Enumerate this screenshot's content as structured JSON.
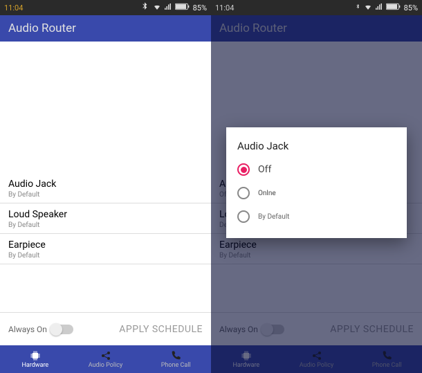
{
  "statusbar": {
    "time": "11:04",
    "battery_pct": "85%"
  },
  "appbar": {
    "title": "Audio Router"
  },
  "settings": [
    {
      "title": "Audio Jack",
      "sub": "By Default"
    },
    {
      "title": "Loud Speaker",
      "sub": "By Default"
    },
    {
      "title": "Earpiece",
      "sub": "By Default"
    }
  ],
  "settings2": [
    {
      "title_trunc": "Au",
      "sub_trunc": "Off"
    },
    {
      "title_trunc": "Lou",
      "sub_trunc": "De"
    },
    {
      "title": "Earpiece",
      "sub": "By Default"
    }
  ],
  "schedule": {
    "always_on": "Always On",
    "apply": "APPLY SCHEDULE"
  },
  "nav": {
    "hardware": "Hardware",
    "audio_policy": "Audio Policy",
    "phone_call": "Phone Call"
  },
  "dialog": {
    "title": "Audio Jack",
    "options": [
      {
        "label": "Off",
        "checked": true
      },
      {
        "label": "Onlne",
        "checked": false
      },
      {
        "label": "By Default",
        "checked": false
      }
    ]
  }
}
